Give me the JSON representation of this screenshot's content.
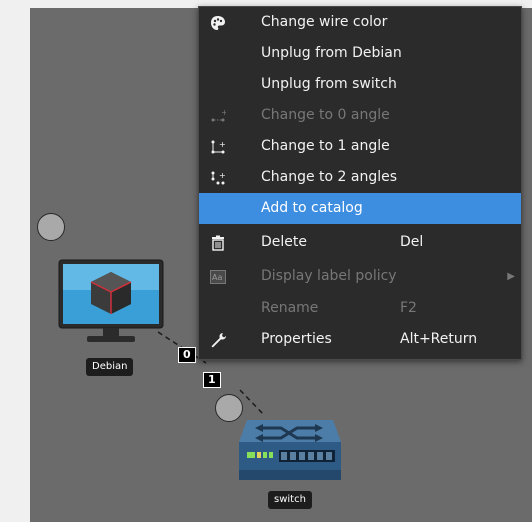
{
  "devices": {
    "debian": {
      "label": "Debian"
    },
    "switch": {
      "label": "switch"
    }
  },
  "ports": {
    "debian_port": "0",
    "switch_port": "1"
  },
  "context_menu": {
    "items": [
      {
        "label": "Change wire color",
        "icon": "palette-icon",
        "shortcut": "",
        "disabled": false
      },
      {
        "label": "Unplug from Debian",
        "icon": "",
        "shortcut": "",
        "disabled": false
      },
      {
        "label": "Unplug from switch",
        "icon": "",
        "shortcut": "",
        "disabled": false
      },
      {
        "label": "Change to 0 angle",
        "icon": "angle-0-icon",
        "shortcut": "",
        "disabled": true
      },
      {
        "label": "Change to 1 angle",
        "icon": "angle-1-icon",
        "shortcut": "",
        "disabled": false
      },
      {
        "label": "Change to 2 angles",
        "icon": "angle-2-icon",
        "shortcut": "",
        "disabled": false
      },
      {
        "label": "Add to catalog",
        "icon": "",
        "shortcut": "",
        "disabled": false,
        "highlighted": true
      },
      {
        "label": "Delete",
        "icon": "trash-icon",
        "shortcut": "Del",
        "disabled": false
      },
      {
        "label": "Display label policy",
        "icon": "label-icon",
        "shortcut": "",
        "disabled": true,
        "submenu": true
      },
      {
        "label": "Rename",
        "icon": "",
        "shortcut": "F2",
        "disabled": true
      },
      {
        "label": "Properties",
        "icon": "wrench-icon",
        "shortcut": "Alt+Return",
        "disabled": false
      }
    ]
  },
  "colors": {
    "canvas": "#6b6b6b",
    "menu_bg": "#2b2b2b",
    "highlight": "#3d8ee0"
  }
}
